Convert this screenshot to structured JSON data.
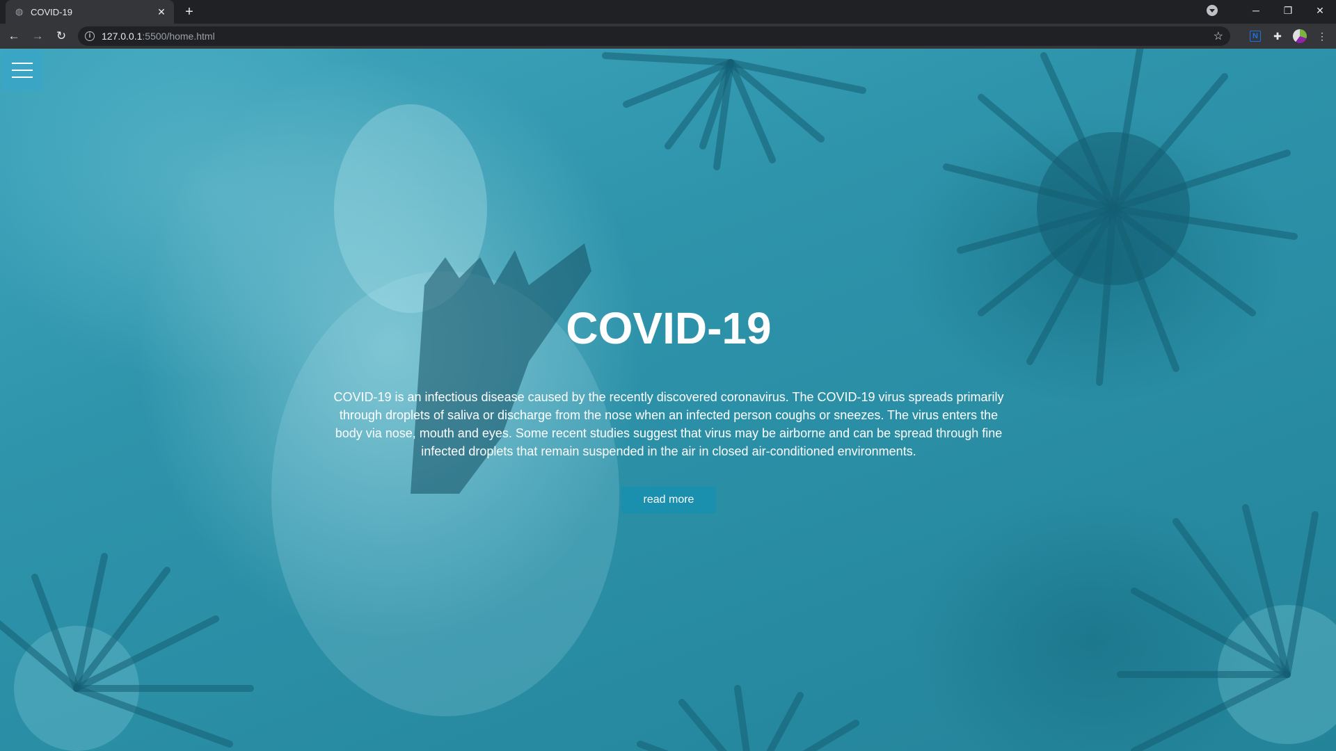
{
  "browser": {
    "tab": {
      "title": "COVID-19",
      "favicon": "globe-icon",
      "close": "✕"
    },
    "new_tab": "+",
    "url_host": "127.0.0.1",
    "url_path": ":5500/home.html",
    "window_controls": {
      "minimize": "─",
      "restore": "❐",
      "close": "✕"
    },
    "nav": {
      "back": "←",
      "forward": "→",
      "reload": "↻"
    },
    "toolbar_icons": {
      "bookmark": "☆",
      "extension": "N",
      "puzzle": "✚",
      "menu": "⋮"
    }
  },
  "page": {
    "menu_icon": "hamburger-menu-icon",
    "hero": {
      "title": "COVID-19",
      "description": "COVID-19 is an infectious disease caused by the recently discovered coronavirus. The COVID-19 virus spreads primarily through droplets of saliva or discharge from the nose when an infected person coughs or sneezes. The virus enters the body via nose, mouth and eyes. Some recent studies suggest that virus may be airborne and can be spread through fine infected droplets that remain suspended in the air in closed air-conditioned environments.",
      "button_label": "read more"
    }
  },
  "colors": {
    "background": "#2e94ab",
    "menu_button": "#3aa5c4",
    "read_more_button": "#1b8fae",
    "text": "#ffffff"
  }
}
